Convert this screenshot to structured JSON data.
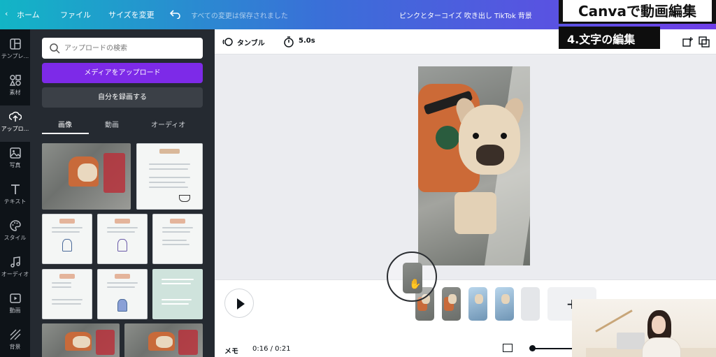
{
  "topbar": {
    "home": "ホーム",
    "file": "ファイル",
    "resize": "サイズを変更",
    "saved_status": "すべての変更は保存されました",
    "doc_title": "ピンクとターコイズ 吹き出し TikTok 背景"
  },
  "rail": {
    "items": [
      {
        "label": "テンプレ...",
        "icon": "template-icon"
      },
      {
        "label": "素材",
        "icon": "elements-icon"
      },
      {
        "label": "アップロ...",
        "icon": "upload-icon"
      },
      {
        "label": "写真",
        "icon": "photo-icon"
      },
      {
        "label": "テキスト",
        "icon": "text-icon"
      },
      {
        "label": "スタイル",
        "icon": "palette-icon"
      },
      {
        "label": "オーディオ",
        "icon": "music-icon"
      },
      {
        "label": "動画",
        "icon": "video-icon"
      },
      {
        "label": "背景",
        "icon": "background-icon"
      }
    ]
  },
  "panel": {
    "search_placeholder": "アップロードの検索",
    "upload_button": "メディアをアップロード",
    "record_button": "自分を録画する",
    "tabs": [
      "画像",
      "動画",
      "オーディオ"
    ]
  },
  "toolbar": {
    "animate": "タンブル",
    "duration": "5.0s"
  },
  "timeline": {
    "memo": "メモ",
    "time": "0:16 / 0:21",
    "add": "+"
  },
  "captions": {
    "title": "Canvaで動画編集",
    "step": "4.文字の編集"
  },
  "colors": {
    "purple": "#7d2ae8",
    "dark_panel": "#252a31",
    "rail": "#0e1318"
  }
}
